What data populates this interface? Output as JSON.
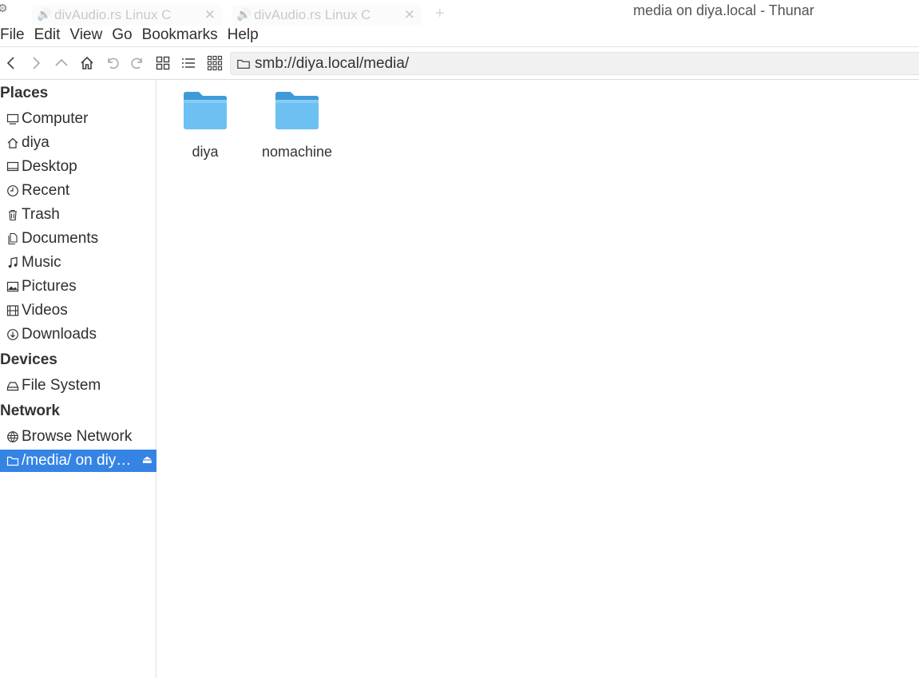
{
  "window": {
    "title": "media on diya.local - Thunar",
    "ghost_tabs": [
      "divAudio.rs Linux C",
      "divAudio.rs Linux C"
    ]
  },
  "menu": [
    "File",
    "Edit",
    "View",
    "Go",
    "Bookmarks",
    "Help"
  ],
  "toolbar": {
    "location": "smb://diya.local/media/"
  },
  "sidebar": {
    "places_header": "Places",
    "places": [
      "Computer",
      "diya",
      "Desktop",
      "Recent",
      "Trash",
      "Documents",
      "Music",
      "Pictures",
      "Videos",
      "Downloads"
    ],
    "devices_header": "Devices",
    "devices": [
      "File System"
    ],
    "network_header": "Network",
    "network": [
      "Browse Network",
      "/media/ on diy…"
    ]
  },
  "files": [
    {
      "name": "diya",
      "icon": "folder-icon"
    },
    {
      "name": "nomachine",
      "icon": "folder-icon"
    }
  ],
  "colors": {
    "selection": "#3584e4",
    "folder_top": "#4aa3df",
    "folder_body": "#6cc0f2"
  }
}
